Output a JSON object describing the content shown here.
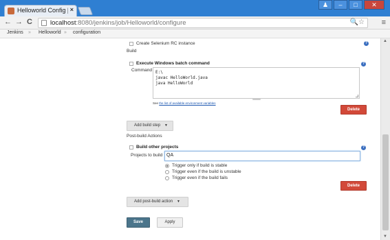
{
  "browser": {
    "tab_title": "Helloworld Config [Je",
    "tab_close": "×",
    "url_host": "localhost",
    "url_path": ":8080/jenkins/job/Helloworld/configure",
    "back": "←",
    "forward": "→",
    "reload": "C",
    "tools": "🔍☆",
    "menu": "≡",
    "win_minimize": "–",
    "win_maximize": "□",
    "win_close": "✕",
    "win_extra": "♟"
  },
  "breadcrumb": {
    "items": [
      "Jenkins",
      "Helloworld",
      "configuration"
    ],
    "separator": "»"
  },
  "colors": {
    "delete_red": "#d24939",
    "save_blue": "#4b758b",
    "help_blue": "#3b6fc0"
  },
  "form": {
    "selenium_label": "Create Selenium RC instance",
    "build_section": "Build",
    "batch_title": "Execute Windows batch command",
    "command_label": "Command",
    "command_lines": [
      "E:\\",
      "javac HelloWorld.java",
      "java HelloWorld"
    ],
    "env_link_prefix": "See ",
    "env_link_text": "the list of available environment variables",
    "delete_label_1": "Delete",
    "add_build_step": "Add build step",
    "post_build_section": "Post-build Actions",
    "build_other_title": "Build other projects",
    "projects_label": "Projects to build",
    "projects_value": "QA",
    "radio_options": [
      "Trigger only if build is stable",
      "Trigger even if the build is unstable",
      "Trigger even if the build fails"
    ],
    "delete_label_2": "Delete",
    "add_post_build": "Add post-build action",
    "save": "Save",
    "apply": "Apply",
    "help_glyph": "?"
  }
}
